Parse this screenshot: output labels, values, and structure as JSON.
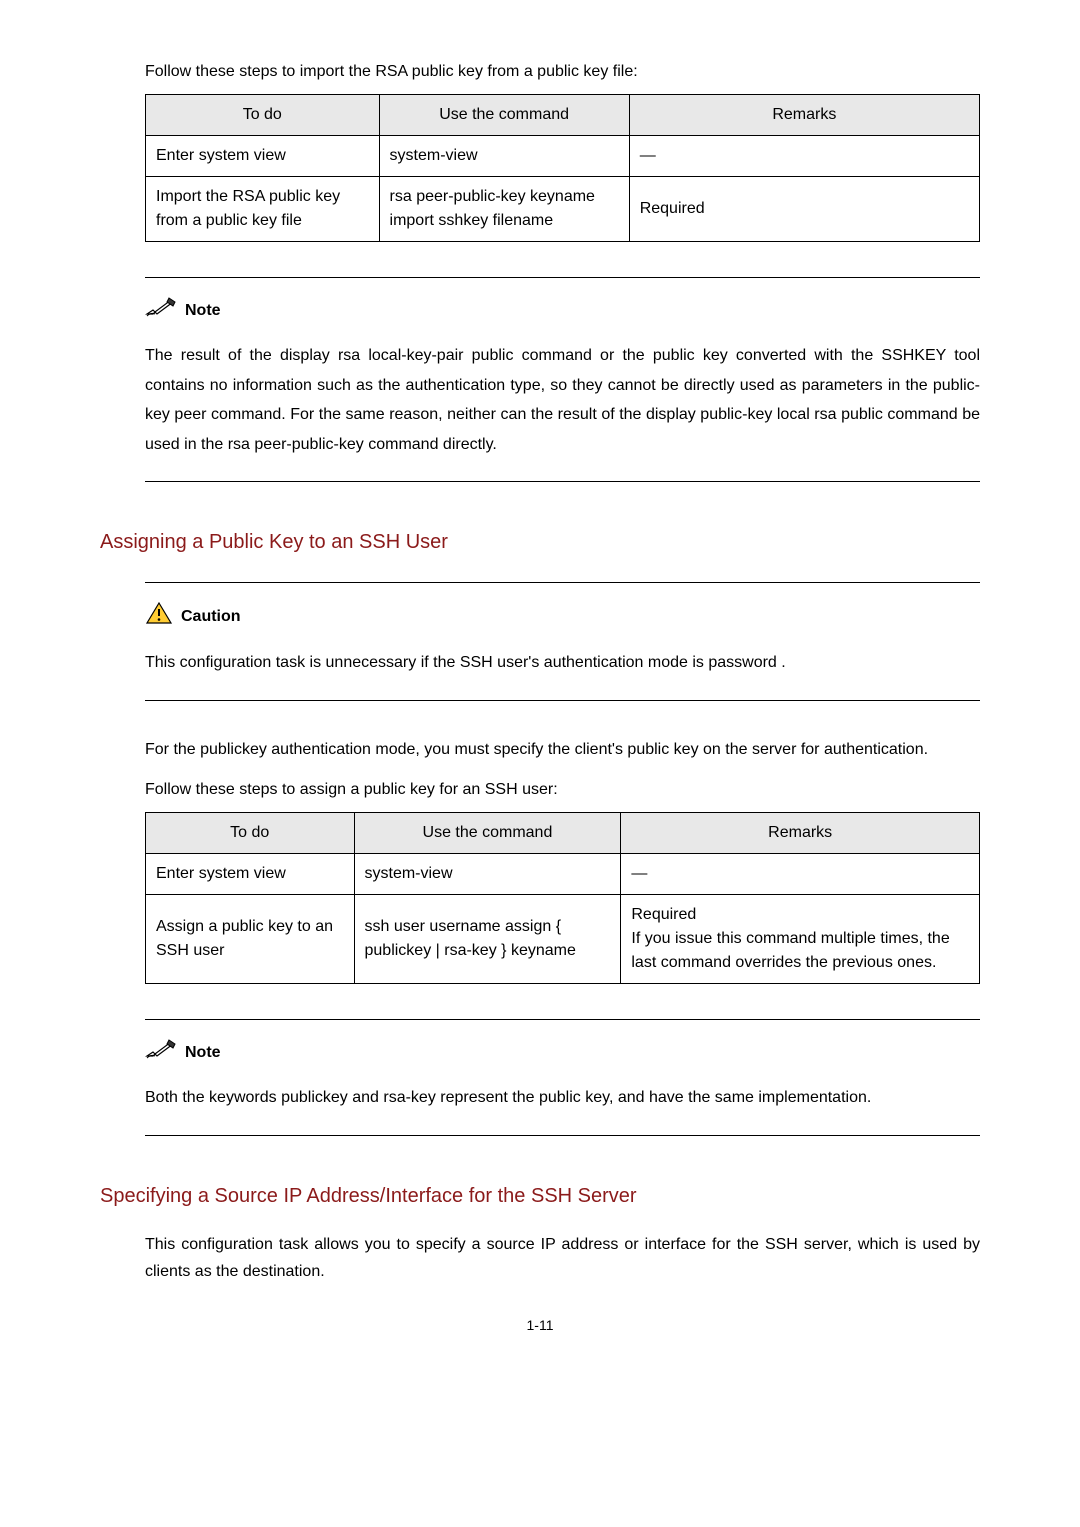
{
  "intro1": "Follow these steps to import the RSA public key from a public key file:",
  "table1": {
    "headers": {
      "col1": "To do",
      "col2": "Use the command",
      "col3": "Remarks"
    },
    "rows": [
      {
        "todo": "Enter system view",
        "command": "system-view",
        "remarks": "—"
      },
      {
        "todo": "Import the RSA public key from a public key file",
        "command": "rsa peer-public-key  keyname import sshkey  filename",
        "remarks": "Required"
      }
    ]
  },
  "note1": {
    "label": "Note",
    "text": "The result of the display rsa local-key-pair public   command or the public key converted with the SSHKEY tool contains no information such as the authentication type, so they cannot be directly used as parameters in the public-key peer  command. For the same reason, neither can the result of the display public-key local rsa public   command be used in the rsa peer-public-key  command directly."
  },
  "heading1": "Assigning a Public Key to an SSH User",
  "caution1": {
    "label": "Caution",
    "text": "This configuration task is unnecessary if the SSH user's authentication mode is password ."
  },
  "para1": "For the publickey  authentication mode, you must specify the client's public key on the server for authentication.",
  "intro2": "Follow these steps to assign a public key for an SSH user:",
  "table2": {
    "headers": {
      "col1": "To do",
      "col2": "Use the command",
      "col3": "Remarks"
    },
    "rows": [
      {
        "todo": "Enter system view",
        "command": "system-view",
        "remarks": "—"
      },
      {
        "todo": "Assign a public key to an SSH user",
        "command": "ssh user  username assign { publickey  | rsa-key } keyname",
        "remarks_line1": "Required",
        "remarks_line2": "If you issue this command multiple times, the last command overrides the previous ones."
      }
    ]
  },
  "note2": {
    "label": "Note",
    "text": "Both the keywords publickey  and rsa-key  represent the public key, and have the same implementation."
  },
  "heading2": "Specifying a Source IP Address/Interface for the SSH Server",
  "para2": "This configuration task allows you to specify a source IP address or interface for the SSH server, which is used by clients as the destination.",
  "pageNumber": "1-11"
}
